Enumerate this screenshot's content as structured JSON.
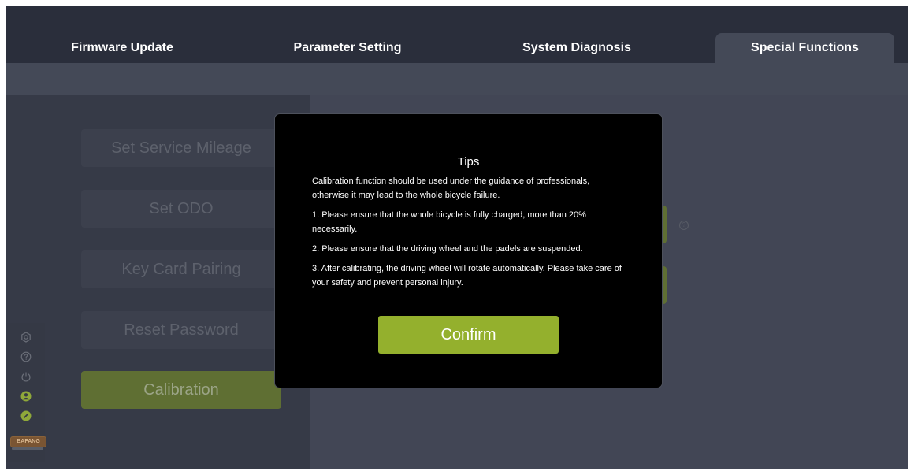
{
  "tabs": [
    {
      "label": "Firmware Update"
    },
    {
      "label": "Parameter Setting"
    },
    {
      "label": "System Diagnosis"
    },
    {
      "label": "Special Functions"
    }
  ],
  "active_tab": "Special Functions",
  "functions": [
    {
      "label": "Set Service Mileage"
    },
    {
      "label": "Set ODO"
    },
    {
      "label": "Key Card Pairing"
    },
    {
      "label": "Reset Password"
    },
    {
      "label": "Calibration"
    }
  ],
  "active_function": "Calibration",
  "sidebar_icons": [
    "settings-icon",
    "help-icon",
    "power-icon",
    "user-icon",
    "link-icon"
  ],
  "brand": {
    "label": "BAFANG"
  },
  "modal": {
    "title": "Tips",
    "intro": "Calibration function should be used under the guidance of professionals, otherwise it may lead to the whole bicycle failure.",
    "items": [
      "1. Please ensure that the whole bicycle is fully charged, more than 20% necessarily.",
      "2. Please ensure that the driving wheel and the padels are suspended.",
      "3. After calibrating, the driving wheel will rotate automatically. Please take care of your safety and prevent personal injury."
    ],
    "confirm_label": "Confirm"
  },
  "colors": {
    "accent": "#94b02d",
    "background": "#2e3240",
    "modal_background": "#000000"
  }
}
